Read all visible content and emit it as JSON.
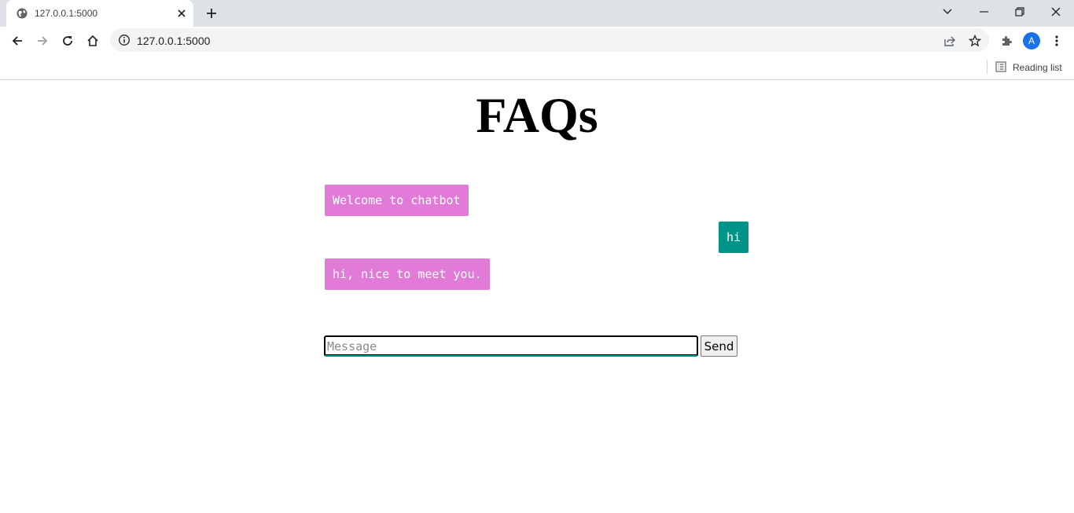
{
  "browser": {
    "tab_title": "127.0.0.1:5000",
    "url": "127.0.0.1:5000",
    "avatar_letter": "A",
    "reading_list_label": "Reading list"
  },
  "page": {
    "title": "FAQs",
    "messages": [
      {
        "sender": "bot",
        "text": "Welcome to chatbot"
      },
      {
        "sender": "user",
        "text": "hi"
      },
      {
        "sender": "bot",
        "text": "hi, nice to meet you."
      }
    ],
    "input_placeholder": "Message",
    "input_value": "",
    "send_label": "Send"
  },
  "colors": {
    "bot_bubble": "#e27bd7",
    "user_bubble": "#009488",
    "avatar": "#1a73e8"
  }
}
